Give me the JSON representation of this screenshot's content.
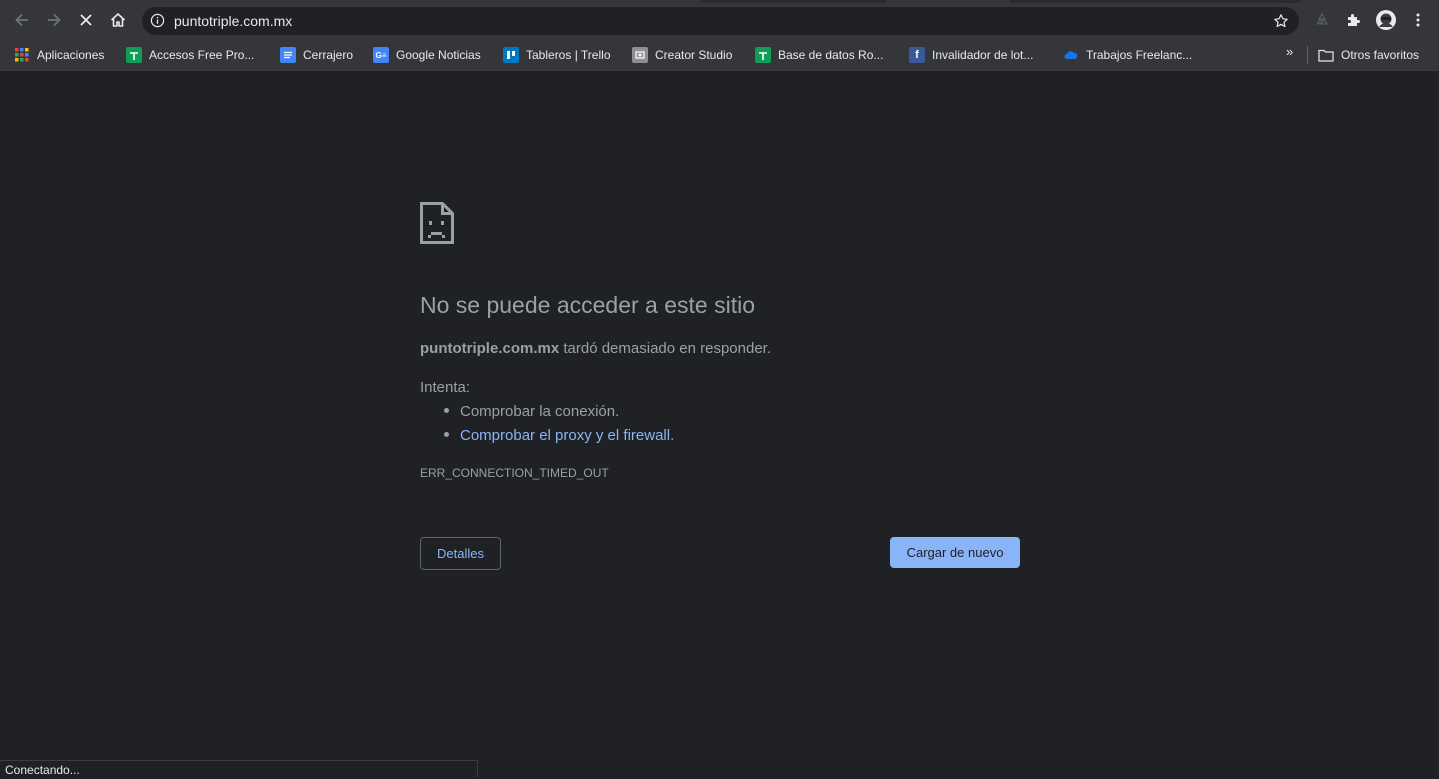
{
  "browser": {
    "url": "puntotriple.com.mx",
    "status_text": "Conectando..."
  },
  "bookmarks": [
    {
      "label": "Aplicaciones",
      "icon": "apps-grid-icon"
    },
    {
      "label": "Accesos Free Pro...",
      "icon": "sheets-icon",
      "color": "#0f9d58"
    },
    {
      "label": "Cerrajero",
      "icon": "docs-icon",
      "color": "#4285f4"
    },
    {
      "label": "Google Noticias",
      "icon": "google-news-icon",
      "color": "#4285f4"
    },
    {
      "label": "Tableros | Trello",
      "icon": "trello-icon",
      "color": "#0079bf"
    },
    {
      "label": "Creator Studio",
      "icon": "creator-studio-icon",
      "color": "#8e8e93"
    },
    {
      "label": "Base de datos Ro...",
      "icon": "sheets-icon",
      "color": "#0f9d58"
    },
    {
      "label": "Invalidador de lot...",
      "icon": "facebook-icon",
      "color": "#3b5998"
    },
    {
      "label": "Trabajos Freelanc...",
      "icon": "cloud-icon",
      "color": "#1a73e8"
    }
  ],
  "bookmarks_more": "»",
  "other_bookmarks": "Otros favoritos",
  "error": {
    "title": "No se puede acceder a este sitio",
    "host": "puntotriple.com.mx",
    "desc_rest": " tardó demasiado en responder.",
    "try_label": "Intenta:",
    "suggestion_1": "Comprobar la conexión.",
    "suggestion_2_link": "Comprobar el proxy y el firewall",
    "suggestion_2_tail": ".",
    "code": "ERR_CONNECTION_TIMED_OUT",
    "details_button": "Detalles",
    "reload_button": "Cargar de nuevo"
  },
  "colors": {
    "accent": "#8ab4f8",
    "background": "#202124",
    "toolbar": "#35363a"
  }
}
